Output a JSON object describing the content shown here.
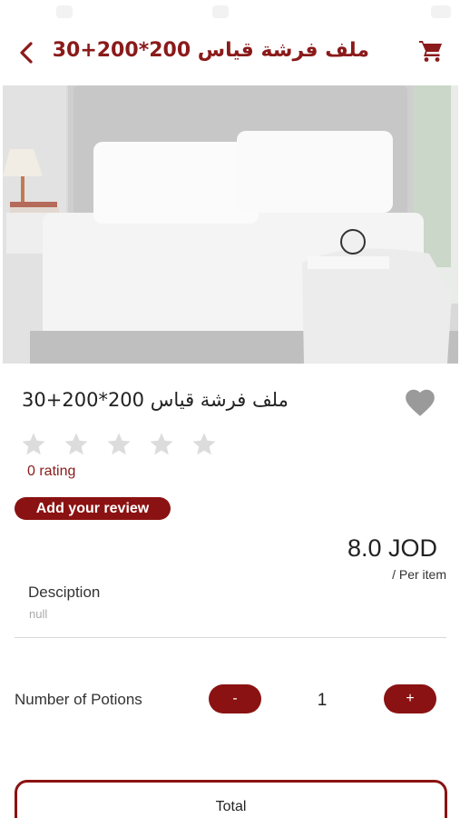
{
  "header": {
    "title": "ملف فرشة قياس 200*200+30",
    "back_icon": "chevron-left-icon",
    "cart_icon": "shopping-cart-icon"
  },
  "product": {
    "title": "ملف فرشة قياس 200*200+30",
    "favorite_icon": "heart-icon",
    "rating": 0,
    "max_rating": 5,
    "rating_text": "0 rating",
    "review_button": "Add your review",
    "price": "8.0 JOD",
    "price_unit": "/ Per item",
    "description_label": "Desciption",
    "description_value": "null"
  },
  "quantity": {
    "label": "Number of Potions",
    "minus_label": "-",
    "plus_label": "+",
    "value": "1"
  },
  "total": {
    "label": "Total"
  },
  "colors": {
    "accent": "#8b1212",
    "title_red": "#8b1a1a",
    "star_empty": "#dcdcdc",
    "heart": "#9a9a9a"
  }
}
